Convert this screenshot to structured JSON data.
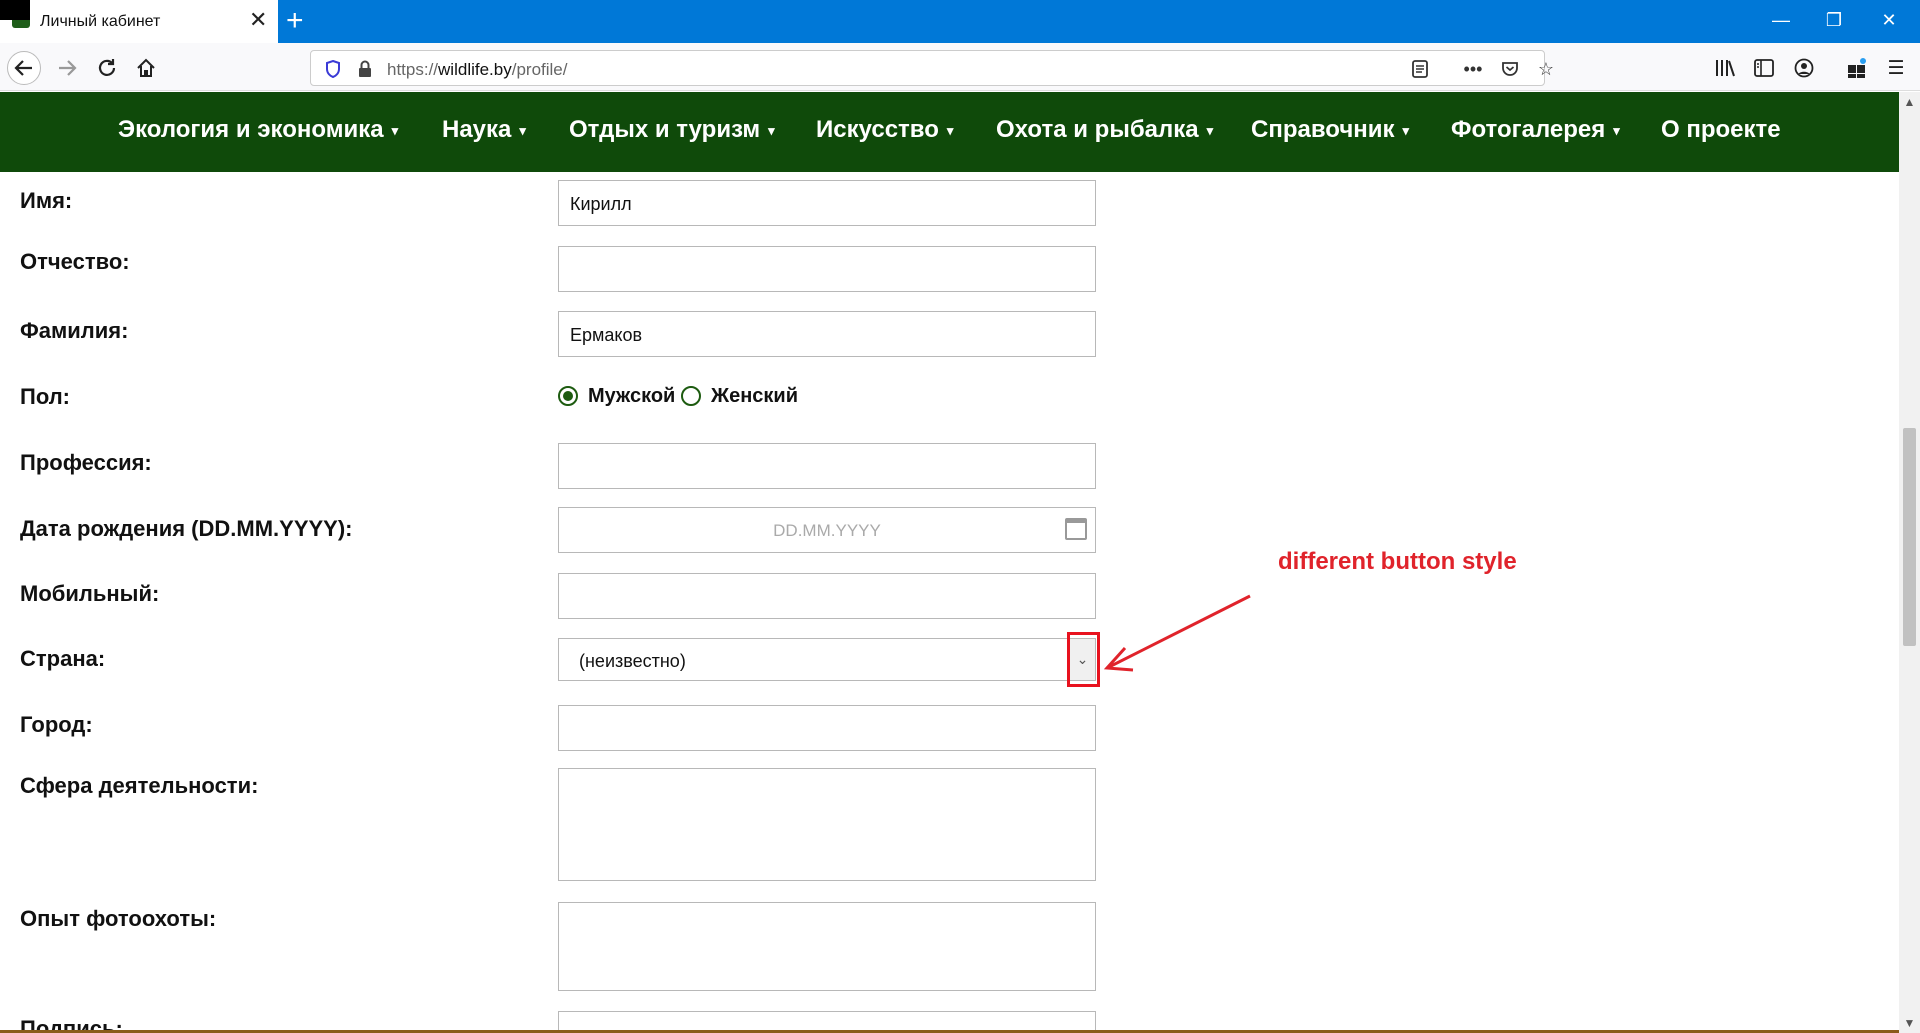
{
  "browser": {
    "tab_title": "Личный кабинет",
    "tab_close": "✕",
    "new_tab": "+",
    "url_prefix": "https://",
    "url_host": "wildlife.by",
    "url_path": "/profile/",
    "window_controls": {
      "minimize": "—",
      "restore": "❐",
      "close": "✕"
    }
  },
  "menu": {
    "items": [
      {
        "label": "Экология и экономика",
        "caret": "▾"
      },
      {
        "label": "Наука",
        "caret": "▾"
      },
      {
        "label": "Отдых и туризм",
        "caret": "▾"
      },
      {
        "label": "Искусство",
        "caret": "▾"
      },
      {
        "label": "Охота и рыбалка",
        "caret": "▾"
      },
      {
        "label": "Справочник",
        "caret": "▾"
      },
      {
        "label": "Фотогалерея",
        "caret": "▾"
      },
      {
        "label": "О проекте",
        "caret": ""
      }
    ]
  },
  "form": {
    "first_name": {
      "label": "Имя:",
      "value": "Кирилл"
    },
    "middle_name": {
      "label": "Отчество:",
      "value": ""
    },
    "last_name": {
      "label": "Фамилия:",
      "value": "Ермаков"
    },
    "gender": {
      "label": "Пол:",
      "options": [
        "Мужской",
        "Женский"
      ],
      "selected": "Мужской"
    },
    "profession": {
      "label": "Профессия:",
      "value": ""
    },
    "birth_date": {
      "label": "Дата рождения (DD.MM.YYYY):",
      "placeholder": "DD.MM.YYYY"
    },
    "mobile": {
      "label": "Мобильный:",
      "value": ""
    },
    "country": {
      "label": "Страна:",
      "value": "(неизвестно)",
      "arrow": "⌄"
    },
    "city": {
      "label": "Город:",
      "value": ""
    },
    "activity": {
      "label": "Сфера деятельности:",
      "value": ""
    },
    "photo_experience": {
      "label": "Опыт фотоохоты:",
      "value": ""
    },
    "signature": {
      "label": "Подпись:"
    }
  },
  "annotation": {
    "text": "different button style",
    "color": "#e0232b"
  },
  "colors": {
    "titlebar": "#0078d7",
    "site_menu": "#0f4a0a",
    "radio": "#1d5b10"
  }
}
